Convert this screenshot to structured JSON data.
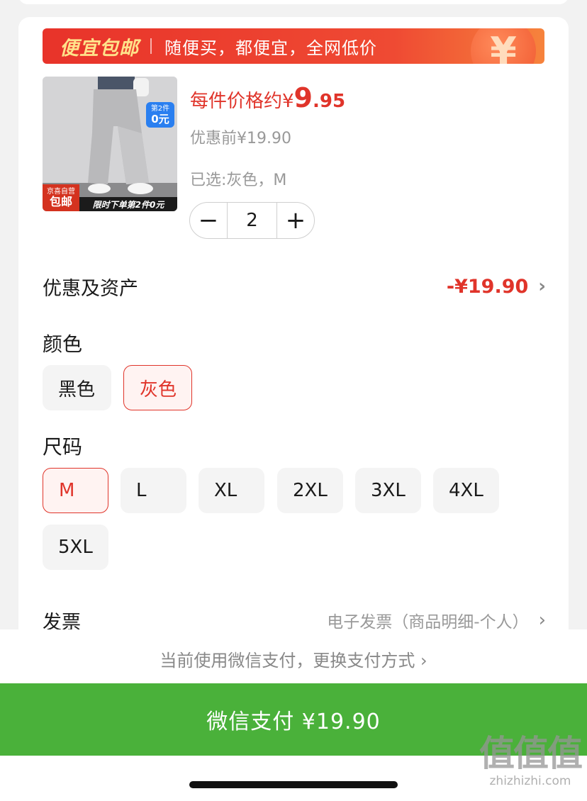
{
  "banner": {
    "title": "便宜包邮",
    "text": "随便买，都便宜，全网低价",
    "coin_glyph": "¥"
  },
  "product": {
    "image_badge_top_line1": "第2件",
    "image_badge_top_line2": "0元",
    "image_badge_self_line1": "京喜自营",
    "image_badge_self_line2": "包邮",
    "image_strip_text": "限时下单第2件0元",
    "price_prefix": "每件价格约¥",
    "price_integer": "9",
    "price_decimal": ".95",
    "price_before": "优惠前¥19.90",
    "selected": "已选:灰色，M",
    "quantity": "2",
    "minus_glyph": "−",
    "plus_glyph": "+"
  },
  "discount": {
    "label": "优惠及资产",
    "value": "-¥19.90",
    "chevron": "›"
  },
  "color": {
    "title": "颜色",
    "options": [
      {
        "label": "黑色",
        "selected": false
      },
      {
        "label": "灰色",
        "selected": true
      }
    ]
  },
  "size": {
    "title": "尺码",
    "options": [
      {
        "label": "M",
        "selected": true
      },
      {
        "label": "L",
        "selected": false
      },
      {
        "label": "XL",
        "selected": false
      },
      {
        "label": "2XL",
        "selected": false
      },
      {
        "label": "3XL",
        "selected": false
      },
      {
        "label": "4XL",
        "selected": false
      },
      {
        "label": "5XL",
        "selected": false
      }
    ]
  },
  "invoice": {
    "label": "发票",
    "value": "电子发票（商品明细-个人）",
    "chevron": "›"
  },
  "payment": {
    "method_text": "当前使用微信支付，更换支付方式 ›",
    "button_label": "微信支付 ¥19.90"
  },
  "watermark": {
    "main": "值值值",
    "url": "zhizhizhi.com"
  },
  "colors": {
    "accent_red": "#e0342a",
    "pay_green": "#4ab13a",
    "badge_blue": "#2a7ff0"
  }
}
